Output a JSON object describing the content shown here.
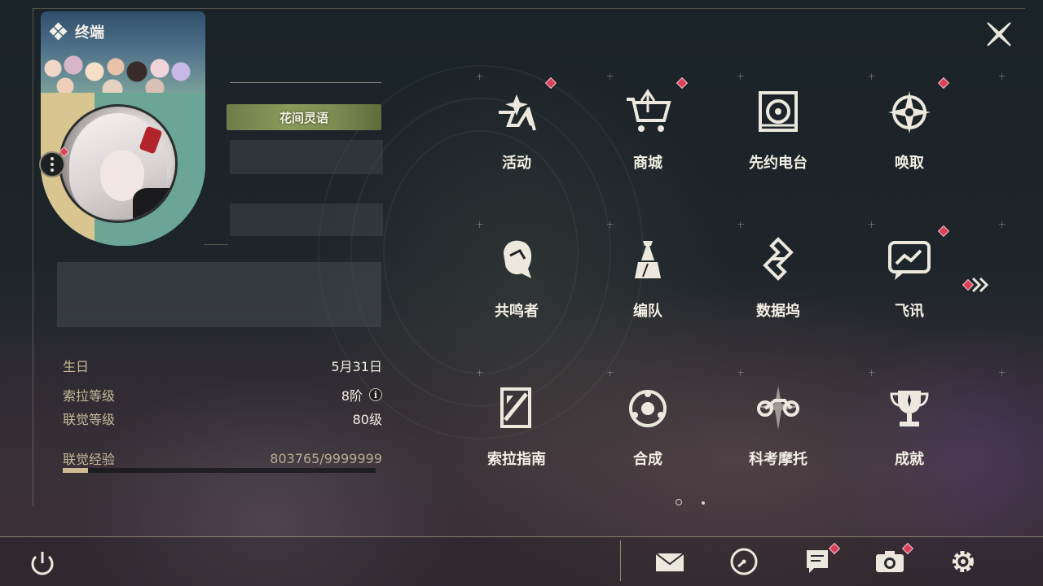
{
  "header": {
    "title": "终端"
  },
  "profile": {
    "title_badge": "花间灵语"
  },
  "stats": {
    "birthday_label": "生日",
    "birthday_value": "5月31日",
    "sola_level_label": "索拉等级",
    "sola_level_value": "8阶",
    "union_level_label": "联觉等级",
    "union_level_value": "80级",
    "union_exp_label": "联觉经验",
    "union_exp_value": "803765/9999999",
    "union_exp_progress": 0.08
  },
  "menu": {
    "items": [
      {
        "label": "活动",
        "icon": "activity-icon",
        "badge": true
      },
      {
        "label": "商城",
        "icon": "shop-cart-icon",
        "badge": true
      },
      {
        "label": "先约电台",
        "icon": "radio-icon",
        "badge": false
      },
      {
        "label": "唤取",
        "icon": "summon-compass-icon",
        "badge": true
      },
      {
        "label": "共鸣者",
        "icon": "resonator-icon",
        "badge": false
      },
      {
        "label": "编队",
        "icon": "team-chess-icon",
        "badge": false
      },
      {
        "label": "数据坞",
        "icon": "data-dock-icon",
        "badge": false
      },
      {
        "label": "飞讯",
        "icon": "message-icon",
        "badge": true
      },
      {
        "label": "索拉指南",
        "icon": "guide-icon",
        "badge": false
      },
      {
        "label": "合成",
        "icon": "synthesis-icon",
        "badge": false
      },
      {
        "label": "科考摩托",
        "icon": "motorbike-icon",
        "badge": false
      },
      {
        "label": "成就",
        "icon": "trophy-icon",
        "badge": false
      }
    ],
    "current_page": 1,
    "page_count": 2
  },
  "bottom_bar": {
    "buttons": [
      "power-icon",
      "mail-icon",
      "clock-icon",
      "notice-icon",
      "camera-icon",
      "settings-gear-icon"
    ]
  },
  "colors": {
    "badge": "#d9405a",
    "accent_gold": "#cdbb93",
    "text": "#f2eee4"
  }
}
